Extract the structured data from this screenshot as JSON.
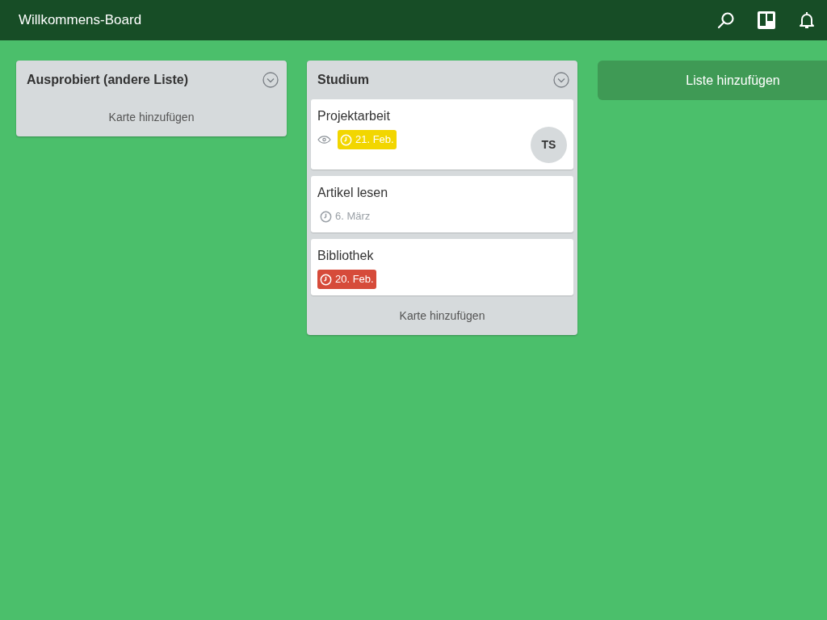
{
  "header": {
    "title": "Willkommens-Board"
  },
  "lists": [
    {
      "title": "Ausprobiert (andere Liste)",
      "add_card": "Karte hinzufügen"
    },
    {
      "title": "Studium",
      "cards": [
        {
          "title": "Projektarbeit",
          "watching": true,
          "due": {
            "text": "21. Feb.",
            "kind": "soon"
          },
          "members": [
            "TS"
          ]
        },
        {
          "title": "Artikel lesen",
          "watching": false,
          "due": {
            "text": "6. März",
            "kind": "plain"
          }
        },
        {
          "title": "Bibliothek",
          "watching": false,
          "due": {
            "text": "20. Feb.",
            "kind": "overdue"
          }
        }
      ],
      "add_card": "Karte hinzufügen"
    }
  ],
  "add_list": "Liste hinzufügen"
}
